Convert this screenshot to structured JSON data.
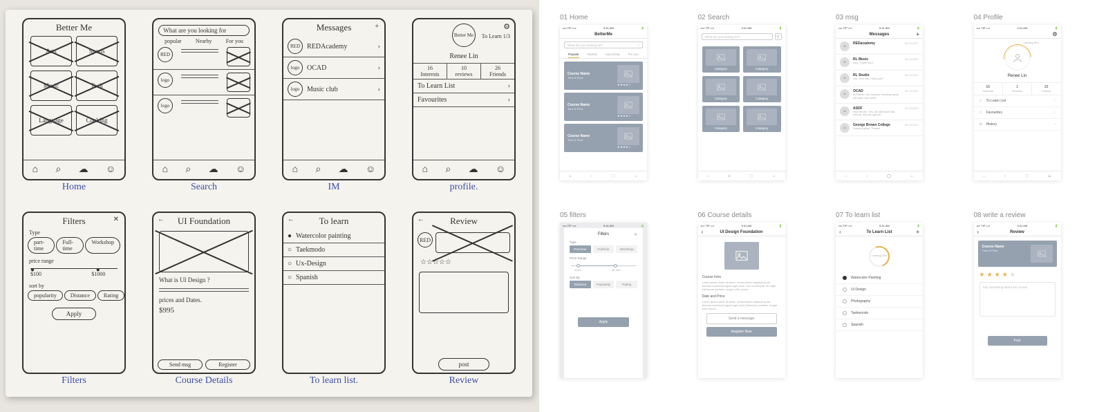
{
  "sketches": {
    "row1": [
      {
        "caption": "Home",
        "title": "Better Me",
        "tiles": [
          "Arts",
          "Sports",
          "Music",
          "Tech",
          "Language",
          "Cooking"
        ]
      },
      {
        "caption": "Search",
        "search": "What are you looking for",
        "tabs": [
          "popular",
          "Nearby",
          "For you"
        ],
        "logo": "RED"
      },
      {
        "caption": "IM",
        "title": "Messages",
        "items": [
          "REDAcademy",
          "OCAD",
          "Music club"
        ]
      },
      {
        "caption": "profile.",
        "title": "Better Me",
        "tolearn": "To Learn 1/3",
        "name": "Renee Lin",
        "stats": [
          {
            "n": "16",
            "l": "Interests"
          },
          {
            "n": "10",
            "l": "reviews"
          },
          {
            "n": "26",
            "l": "Friends"
          }
        ],
        "links": [
          "To Learn List",
          "Favourites"
        ]
      }
    ],
    "row2": [
      {
        "caption": "Filters",
        "title": "Filters",
        "type_l": "Type",
        "types": [
          "part-time",
          "Full-time",
          "Workshop"
        ],
        "price_l": "price range",
        "p1": "$100",
        "p2": "$1000",
        "sort_l": "sort by",
        "sorts": [
          "popularity",
          "Distance",
          "Rating"
        ],
        "apply": "Apply"
      },
      {
        "caption": "Course Details",
        "title": "UI Foundation",
        "q": "What is UI Design ?",
        "p": "prices and Dates.",
        "price": "$995",
        "b1": "Send msg",
        "b2": "Register"
      },
      {
        "caption": "To learn list.",
        "title": "To learn",
        "items": [
          "Watercolor painting",
          "Taekmodo",
          "Ux-Design",
          "Spanish"
        ]
      },
      {
        "caption": "Review",
        "title": "Review",
        "logo": "RED",
        "btn": "post"
      }
    ]
  },
  "wires": {
    "common": {
      "time": "9:41 AM",
      "carrier": "•••• TIP ⟹"
    },
    "w01": {
      "label": "01 Home",
      "title": "BetterMe",
      "search": "What are you looking for?",
      "tabs": [
        "Popular",
        "Nearby",
        "Upcoming",
        "For you"
      ],
      "course": "Course Name",
      "sub": "Time & Price"
    },
    "w02": {
      "label": "02 Search",
      "search": "What are you looking for?",
      "cat": "Category"
    },
    "w03": {
      "label": "03 msg",
      "title": "Messages",
      "rows": [
        {
          "name": "REDacademy",
          "msg": "",
          "date": "09.14.2017"
        },
        {
          "name": "RL Music",
          "msg": "Hey, Thank you!",
          "date": "09.14.2017"
        },
        {
          "name": "RL Studio",
          "msg": "Yes, how can I help you?",
          "date": "09.14.2017"
        },
        {
          "name": "OCAD",
          "msg": "Hi Renee, the summer working camp will start next week",
          "date": "09.13.2017"
        },
        {
          "name": "ASDF",
          "msg": "Hey Renee. Yes, we still have that course, are you gonna…",
          "date": "09.13.2017"
        },
        {
          "name": "George Brown College",
          "msg": "Sounds great. Thanks.",
          "date": "09.13.2017"
        }
      ]
    },
    "w04": {
      "label": "04 Profile",
      "name": "Renee Lin",
      "learning": "Learning 30%",
      "stats": [
        {
          "n": "16",
          "l": "Interests"
        },
        {
          "n": "1",
          "l": "Reviews"
        },
        {
          "n": "22",
          "l": "Friends"
        }
      ],
      "links": [
        "To Learn List",
        "Favourites",
        "History"
      ]
    },
    "w05": {
      "label": "05 filters",
      "title": "Filters",
      "type_l": "Type",
      "types": [
        "Part-time",
        "Full-time",
        "Workshop"
      ],
      "price_l": "Price Range",
      "p1": "$100",
      "p2": "$1,000",
      "sort_l": "Sort By",
      "sorts": [
        "Distance",
        "Popularity",
        "Rating"
      ],
      "apply": "Apply"
    },
    "w06": {
      "label": "06 Course details",
      "title": "UI Design Foundation",
      "intro_h": "Course Intro",
      "intro": "Lorem ipsum dolor sit amet, consectetuer adipiscing elit. Aenean commodo ligula eget dolor. Sed consequat, leo eget bibendum sodales, augue velit cursus.",
      "dp_h": "Date and Price",
      "dp": "Lorem ipsum dolor sit amet, consectetuer adipiscing elit. Aenean commodo ligula eget dolor bibendum sodales, augue velit cursus.",
      "b1": "Send a message",
      "b2": "Register Now"
    },
    "w07": {
      "label": "07 To learn list",
      "title": "To Learn List",
      "pct": "Learning 23%",
      "items": [
        "Watercolor Painting",
        "UI Design",
        "Photography",
        "Taekwondo",
        "Spanish"
      ]
    },
    "w08": {
      "label": "08 write a review",
      "title": "Review",
      "course": "Course Name",
      "sub": "Time & Price",
      "ph": "Say something about the course",
      "btn": "Post"
    }
  }
}
